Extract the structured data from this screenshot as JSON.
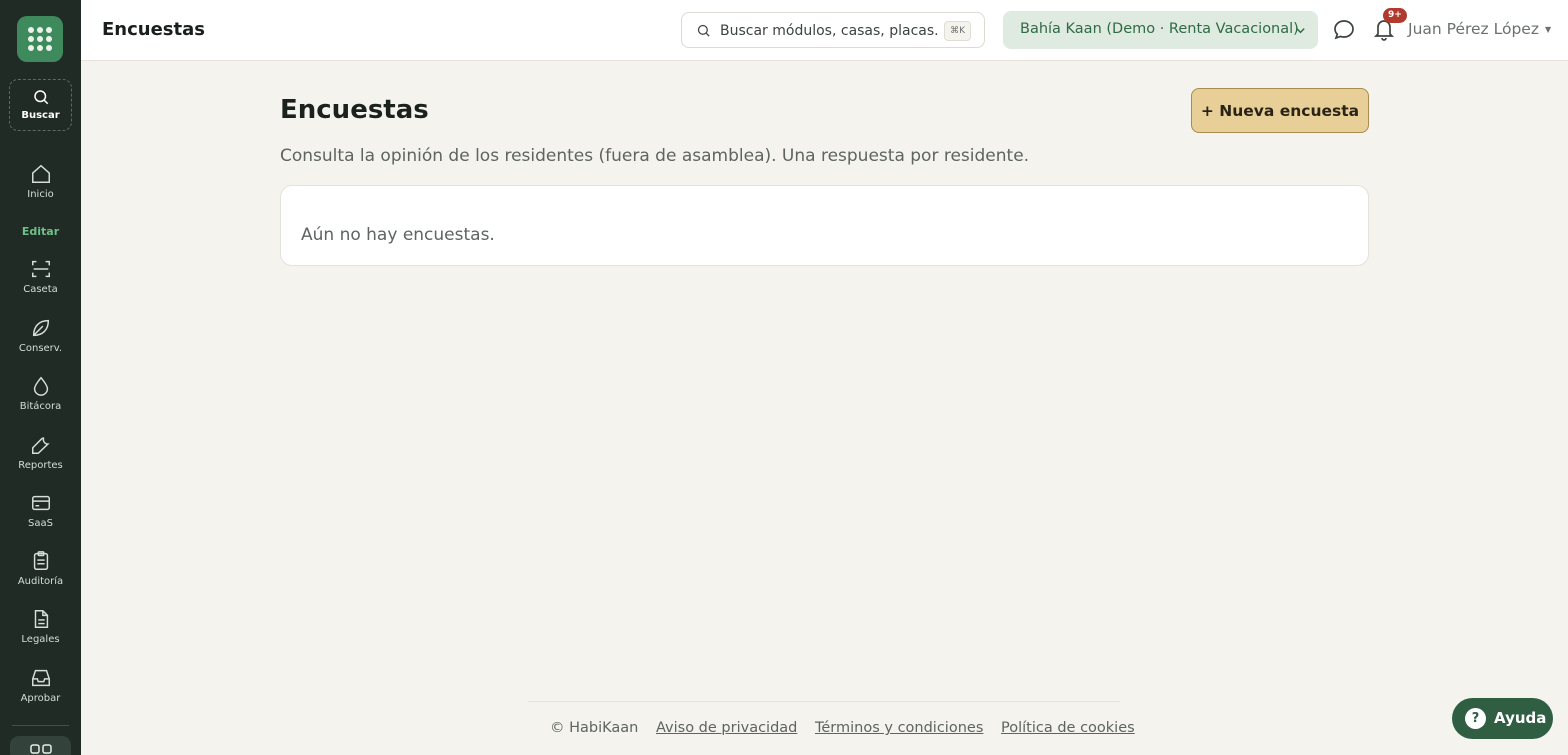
{
  "app": {
    "page_title": "Encuestas"
  },
  "sidebar": {
    "search_label": "Buscar",
    "edit_section_label": "Editar",
    "items": [
      {
        "label": "Inicio",
        "icon": "home-icon"
      },
      {
        "label": "Caseta",
        "icon": "scan-icon"
      },
      {
        "label": "Conserv.",
        "icon": "leaf-icon"
      },
      {
        "label": "Bitácora",
        "icon": "droplet-icon"
      },
      {
        "label": "Reportes",
        "icon": "wrench-icon"
      },
      {
        "label": "SaaS",
        "icon": "card-icon"
      },
      {
        "label": "Auditoría",
        "icon": "clipboard-icon"
      },
      {
        "label": "Legales",
        "icon": "document-icon"
      },
      {
        "label": "Aprobar",
        "icon": "inbox-icon"
      }
    ]
  },
  "header": {
    "title": "Encuestas",
    "search_placeholder": "Buscar módulos, casas, placas...",
    "search_shortcut": "⌘K",
    "org_selector": "Bahía Kaan (Demo · Renta Vacacional)",
    "notification_badge": "9+",
    "user_name": "Juan Pérez López"
  },
  "main": {
    "title": "Encuestas",
    "new_button_label": "+ Nueva encuesta",
    "subtitle": "Consulta la opinión de los residentes (fuera de asamblea). Una respuesta por residente.",
    "empty_message": "Aún no hay encuestas."
  },
  "footer": {
    "copyright": "© HabiKaan",
    "links": [
      "Aviso de privacidad",
      "Términos y condiciones",
      "Política de cookies"
    ]
  },
  "help": {
    "label": "Ayuda",
    "icon_glyph": "?"
  },
  "colors": {
    "sidebar_bg": "#1f2b24",
    "brand_green": "#3f8a5c",
    "accent_button": "#e8cf98",
    "page_bg": "#f4f3ee",
    "badge": "#b03a2e"
  }
}
